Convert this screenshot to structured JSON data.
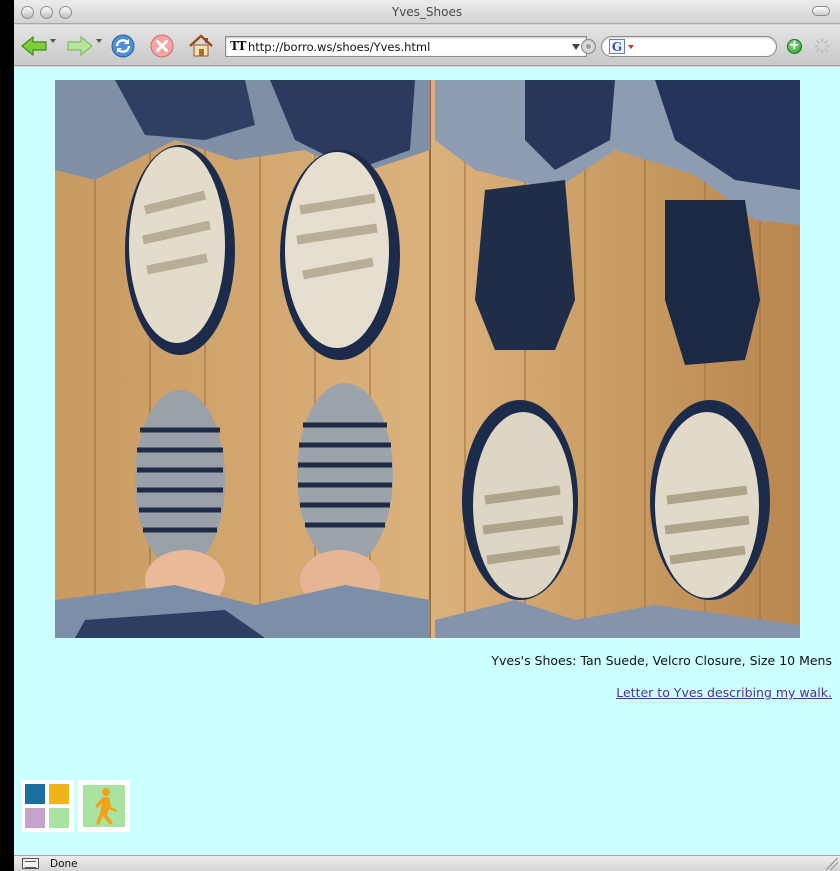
{
  "window": {
    "title": "Yves_Shoes"
  },
  "toolbar": {
    "url": "http://borro.ws/shoes/Yves.html",
    "search_engine_letter": "G"
  },
  "main": {
    "photo_alt": "Yves's shoes and socks on a wooden floor",
    "caption": "Yves's Shoes: Tan Suede, Velcro Closure, Size 10 Mens",
    "letter_link": "Letter to Yves describing my walk."
  },
  "badges": {
    "colors": [
      "#1a6f9e",
      "#f2b21a",
      "#c6a2cf",
      "#a9e3a2"
    ],
    "walker_color": "#f2a21a"
  },
  "status": {
    "text": "Done"
  },
  "icons": {
    "back": "back-arrow-icon",
    "forward": "forward-arrow-icon",
    "reload": "reload-icon",
    "stop": "stop-icon",
    "home": "home-icon",
    "spinner": "activity-spinner-icon"
  }
}
